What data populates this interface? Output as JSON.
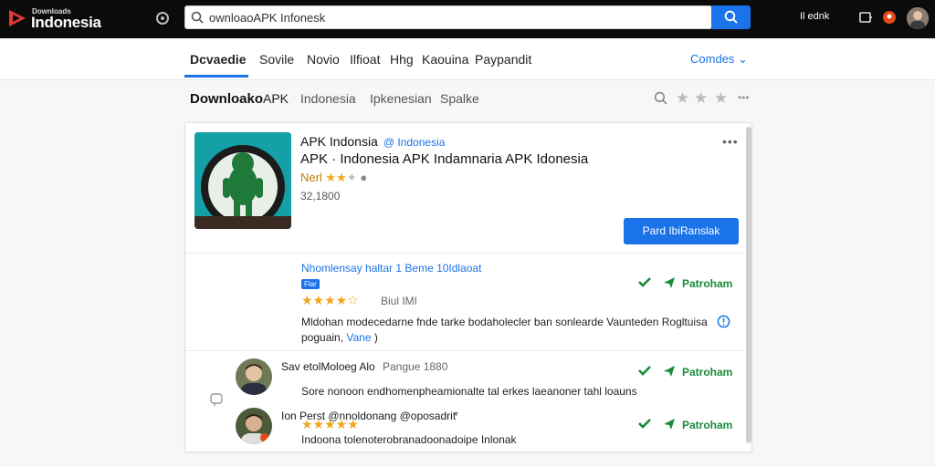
{
  "header": {
    "logo_small": "Downloads",
    "logo_big": "Indonesia",
    "search_value": "ownloaoAPK  Infonesk",
    "right_label": "Il ednk"
  },
  "tabs": [
    {
      "label": "Dcvaedie"
    },
    {
      "label": "Sovile"
    },
    {
      "label": "Novio"
    },
    {
      "label": "Ilfioat"
    },
    {
      "label": "Hhg"
    },
    {
      "label": "Kaouina"
    },
    {
      "label": "Paypandit"
    }
  ],
  "tab_more": "Comdes",
  "breadcrumb": [
    {
      "label": "Downloako"
    },
    {
      "label": "APK"
    },
    {
      "label": "Indonesia"
    },
    {
      "label": "Ipkenesian"
    },
    {
      "label": "Spalke"
    }
  ],
  "app": {
    "title": "APK Indonsia",
    "developer": "@ Indonesia",
    "subtitle": "APK · Indonesia APK Indamnaria APK Idonesia",
    "rating_label": "Nerl",
    "rating": 2.5,
    "count": "32,1800",
    "install_label": "Pard IbiRanslak"
  },
  "reviews": [
    {
      "title": "Nhomlensay haltar 1 Beme 10Idlaoat",
      "badge": "Flar",
      "stars": "★★★★☆",
      "rating": 4.5,
      "meta": "Biul IMI",
      "body": "Mldohan modecedarne fnde tarke bodaholecler ban sonlearde Vaunteden Rogltuisa",
      "body2": "poguain, ",
      "link": "Vane",
      "link_after": " )",
      "action": "Patroham"
    },
    {
      "author": "Sav etolMoloeg Alo",
      "meta": "Pangue 1880",
      "body": "Sore nonoon endhomenpheamionalte tal erkes laeanoner tahl loauns",
      "action": "Patroham"
    },
    {
      "author": "Ion Perst @nnoldonang @oposadrit",
      "stars": "★★★★★",
      "rating": 5,
      "body": "Indoona tolenoterobranadoonadoipe Inlonak",
      "action": "Patroham"
    }
  ],
  "colors": {
    "accent": "#1a73e8",
    "topbar": "#0b0b0b",
    "action_green": "#1a8a3c",
    "star": "#f1a51b"
  }
}
